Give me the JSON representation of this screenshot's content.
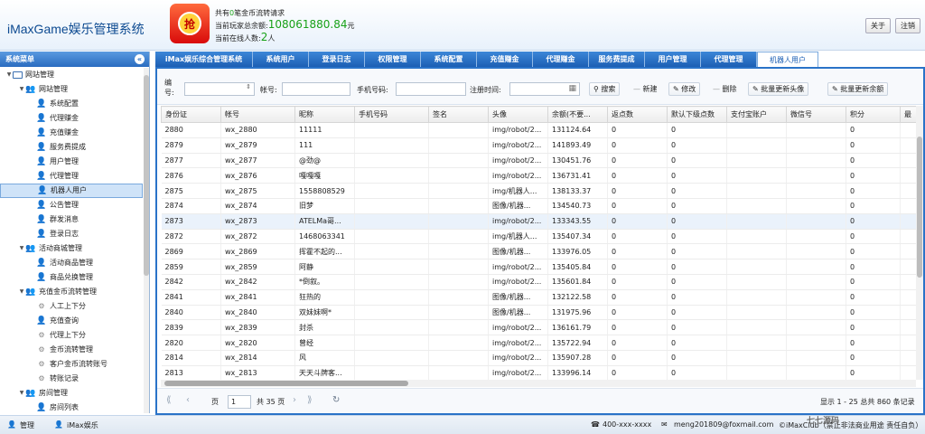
{
  "header": {
    "app_title": "iMaxGame娱乐管理系统",
    "logo_char": "抢",
    "stat1_prefix": "共有",
    "stat1_value": "0",
    "stat1_suffix": "笔金币流转请求",
    "stat2_prefix": "当前玩家总余额:",
    "stat2_value": "108061880.84",
    "stat2_suffix": "元",
    "stat3_prefix": "当前在线人数:",
    "stat3_value": "2",
    "stat3_suffix": "人",
    "about_label": "关于",
    "logout_label": "注销"
  },
  "sidebar": {
    "title": "系统菜单",
    "collapse_icon": "«",
    "tree": [
      {
        "label": "网站管理",
        "level": 0,
        "type": "root"
      },
      {
        "label": "网站管理",
        "level": 1,
        "type": "group"
      },
      {
        "label": "系统配置",
        "level": 2,
        "type": "item"
      },
      {
        "label": "代理赚金",
        "level": 2,
        "type": "item"
      },
      {
        "label": "充值赚金",
        "level": 2,
        "type": "item"
      },
      {
        "label": "服务费提成",
        "level": 2,
        "type": "item"
      },
      {
        "label": "用户管理",
        "level": 2,
        "type": "item"
      },
      {
        "label": "代理管理",
        "level": 2,
        "type": "item"
      },
      {
        "label": "机器人用户",
        "level": 2,
        "type": "item",
        "selected": true
      },
      {
        "label": "公告管理",
        "level": 2,
        "type": "item"
      },
      {
        "label": "群发消息",
        "level": 2,
        "type": "item"
      },
      {
        "label": "登录日志",
        "level": 2,
        "type": "item"
      },
      {
        "label": "活动商城管理",
        "level": 1,
        "type": "group"
      },
      {
        "label": "活动商品管理",
        "level": 2,
        "type": "item"
      },
      {
        "label": "商品兑换管理",
        "level": 2,
        "type": "item"
      },
      {
        "label": "充值金币流转管理",
        "level": 1,
        "type": "group"
      },
      {
        "label": "人工上下分",
        "level": 2,
        "type": "gear"
      },
      {
        "label": "充值查询",
        "level": 2,
        "type": "item"
      },
      {
        "label": "代理上下分",
        "level": 2,
        "type": "gear"
      },
      {
        "label": "金币流转管理",
        "level": 2,
        "type": "gear"
      },
      {
        "label": "客户金币流转账号",
        "level": 2,
        "type": "gear"
      },
      {
        "label": "转账记录",
        "level": 2,
        "type": "gear"
      },
      {
        "label": "房间管理",
        "level": 1,
        "type": "group"
      },
      {
        "label": "房间列表",
        "level": 2,
        "type": "item"
      }
    ]
  },
  "tabs": [
    {
      "label": "iMax娱乐综合管理系统",
      "width": 108
    },
    {
      "label": "系统用户",
      "width": 62
    },
    {
      "label": "登录日志",
      "width": 62
    },
    {
      "label": "权限管理",
      "width": 62
    },
    {
      "label": "系统配置",
      "width": 62
    },
    {
      "label": "充值赚金",
      "width": 62
    },
    {
      "label": "代理赚金",
      "width": 62
    },
    {
      "label": "服务费提成",
      "width": 62
    },
    {
      "label": "用户管理",
      "width": 62
    },
    {
      "label": "代理管理",
      "width": 62
    },
    {
      "label": "机器人用户",
      "width": 68,
      "active": true
    }
  ],
  "toolbar": {
    "id_label_line1": "编",
    "id_label_line2": "号:",
    "account_label": "帐号:",
    "phone_label": "手机号码:",
    "regtime_label": "注册时间:",
    "search_label": "搜索",
    "new_label": "新建",
    "edit_label": "修改",
    "delete_label": "删除",
    "batch_avatar_label": "批量更新头像",
    "batch_balance_label": "批量更新余额"
  },
  "grid": {
    "columns": [
      "身份证",
      "帐号",
      "昵称",
      "手机号码",
      "签名",
      "头像",
      "余额(不要...",
      "返点数",
      "默认下级点数",
      "支付宝账户",
      "微信号",
      "积分",
      "最"
    ],
    "rows": [
      [
        "2880",
        "wx_2880",
        "11111",
        "",
        "",
        "img/robot/2...",
        "131124.64",
        "0",
        "0",
        "",
        "",
        "0",
        ""
      ],
      [
        "2879",
        "wx_2879",
        "111",
        "",
        "",
        "img/robot/2...",
        "141893.49",
        "0",
        "0",
        "",
        "",
        "0",
        ""
      ],
      [
        "2877",
        "wx_2877",
        "@劲@",
        "",
        "",
        "img/robot/2...",
        "130451.76",
        "0",
        "0",
        "",
        "",
        "0",
        ""
      ],
      [
        "2876",
        "wx_2876",
        "嘎嘎嘎",
        "",
        "",
        "img/robot/2...",
        "136731.41",
        "0",
        "0",
        "",
        "",
        "0",
        ""
      ],
      [
        "2875",
        "wx_2875",
        "1558808529",
        "",
        "",
        "img/机器人...",
        "138133.37",
        "0",
        "0",
        "",
        "",
        "0",
        ""
      ],
      [
        "2874",
        "wx_2874",
        "旧梦",
        "",
        "",
        "图像/机器...",
        "134540.73",
        "0",
        "0",
        "",
        "",
        "0",
        ""
      ],
      [
        "2873",
        "wx_2873",
        "ATELMa哥...",
        "",
        "",
        "img/robot/2...",
        "133343.55",
        "0",
        "0",
        "",
        "",
        "0",
        ""
      ],
      [
        "2872",
        "wx_2872",
        "1468063341",
        "",
        "",
        "img/机器人...",
        "135407.34",
        "0",
        "0",
        "",
        "",
        "0",
        ""
      ],
      [
        "2869",
        "wx_2869",
        "挥霍不起的...",
        "",
        "",
        "图像/机器...",
        "133976.05",
        "0",
        "0",
        "",
        "",
        "0",
        ""
      ],
      [
        "2859",
        "wx_2859",
        "阿静",
        "",
        "",
        "img/robot/2...",
        "135405.84",
        "0",
        "0",
        "",
        "",
        "0",
        ""
      ],
      [
        "2842",
        "wx_2842",
        "*倒叙。",
        "",
        "",
        "img/robot/2...",
        "135601.84",
        "0",
        "0",
        "",
        "",
        "0",
        ""
      ],
      [
        "2841",
        "wx_2841",
        "狂热的",
        "",
        "",
        "图像/机器...",
        "132122.58",
        "0",
        "0",
        "",
        "",
        "0",
        ""
      ],
      [
        "2840",
        "wx_2840",
        "双妹妹啊*",
        "",
        "",
        "图像/机器...",
        "131975.96",
        "0",
        "0",
        "",
        "",
        "0",
        ""
      ],
      [
        "2839",
        "wx_2839",
        "封杀",
        "",
        "",
        "img/robot/2...",
        "136161.79",
        "0",
        "0",
        "",
        "",
        "0",
        ""
      ],
      [
        "2820",
        "wx_2820",
        "曾经",
        "",
        "",
        "img/robot/2...",
        "135722.94",
        "0",
        "0",
        "",
        "",
        "0",
        ""
      ],
      [
        "2814",
        "wx_2814",
        "风",
        "",
        "",
        "img/robot/2...",
        "135907.28",
        "0",
        "0",
        "",
        "",
        "0",
        ""
      ],
      [
        "2813",
        "wx_2813",
        "天天斗牌客...",
        "",
        "",
        "img/robot/2...",
        "133996.14",
        "0",
        "0",
        "",
        "",
        "0",
        ""
      ]
    ],
    "highlight_row": 6
  },
  "pager": {
    "page_label": "页",
    "page_value": "1",
    "total_pages": "共 35 页",
    "summary": "显示 1 - 25 总共 860 条记录"
  },
  "footer": {
    "admin_label": "管理",
    "org_label": "iMax娱乐",
    "phone": "400-xxx-xxxx",
    "email": "meng201809@foxmail.com",
    "copyright": "©iMaxClub（禁止非法商业用途 责任自负）",
    "watermark": "七七源码"
  },
  "icons": {
    "search": "search-icon",
    "new": "new-icon",
    "edit": "edit-icon",
    "delete": "delete-icon",
    "refresh": "refresh-icon",
    "calendar": "calendar-icon"
  }
}
